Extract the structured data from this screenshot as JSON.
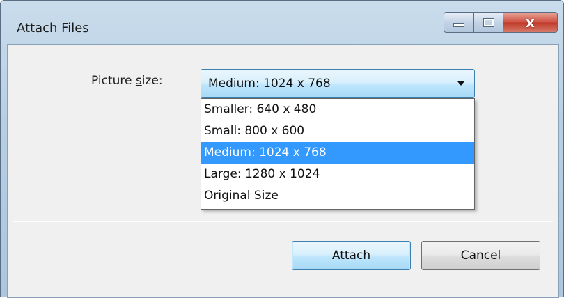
{
  "window": {
    "title": "Attach Files",
    "minimize_icon": "minimize-icon",
    "maximize_icon": "maximize-icon",
    "close_icon": "close-icon",
    "close_glyph": "x"
  },
  "form": {
    "picture_size_label_pre": "Picture ",
    "picture_size_label_mnemonic": "s",
    "picture_size_label_post": "ize:",
    "combo_value": "Medium: 1024 x 768",
    "options": [
      {
        "label": "Smaller: 640 x 480",
        "selected": false
      },
      {
        "label": "Small: 800 x 600",
        "selected": false
      },
      {
        "label": "Medium: 1024 x 768",
        "selected": true
      },
      {
        "label": "Large: 1280 x 1024",
        "selected": false
      },
      {
        "label": "Original Size",
        "selected": false
      }
    ]
  },
  "buttons": {
    "attach_label": "Attach",
    "cancel_mnemonic": "C",
    "cancel_rest": "ancel"
  },
  "colors": {
    "selection": "#3399ff",
    "close_button": "#c13b2b",
    "focus_border": "#3c7fb1"
  }
}
